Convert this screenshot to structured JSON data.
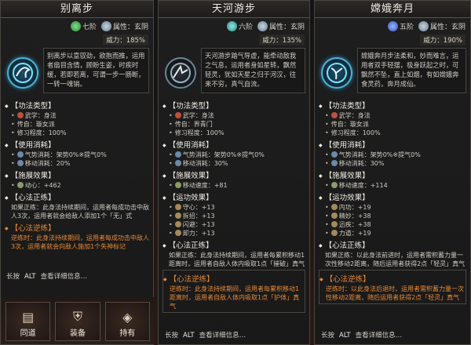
{
  "panels": [
    {
      "title": "别离步",
      "rank": "七阶",
      "attr": "属性：玄阴",
      "power": "威力：185%",
      "desc": "别离步以意驭劲，欲抱而推，运用者扇目含情，顾盼生姿，时疾时缓，若即若离，可谓一步一肠断，一转一魂销。",
      "func_h": "【功法类型】",
      "func": [
        "武学：身法",
        "传自：璇女派",
        "修习程度：100%"
      ],
      "use_h": "【使用消耗】",
      "use": [
        "气势消耗：架势0%※提气0%",
        "移动消耗：20%"
      ],
      "eff_h": "【施展效果】",
      "eff": [
        "动心：+462"
      ],
      "zheng_h": "【心法正练】",
      "zheng": "如果正练：此身法持续期间，运用者每成功击中敌人3次，运用者就会给敌人添加1个「无」式",
      "ni_h": "【心法逆练】",
      "ni": "逆练时：此身法持续期间，运用者每成功击中敌人3次，运用者就会向敌人施加1个失神标记",
      "foot_a": "长按",
      "foot_b": "ALT",
      "foot_c": "查看详细信息…"
    },
    {
      "title": "天河游步",
      "rank": "六阶",
      "attr": "属性：玄阴",
      "power": "威力：135%",
      "desc": "天河游步踏气导虚，能牵动敌我之气息，运用者身如星转，飘然轻灵，犹如天星之归于河汉，往来不穷，真气自流。",
      "func_h": "【功法类型】",
      "func": [
        "武学：身法",
        "传自：界青门",
        "修习程度：100%"
      ],
      "use_h": "【使用消耗】",
      "use": [
        "气势消耗：架势0%※提气0%",
        "移动消耗：30%"
      ],
      "eff_h": "【施展效果】",
      "eff": [
        "移动速度：+81"
      ],
      "yun_h": "【运功效果】",
      "yun": [
        "守心：+13",
        "拆招：+13",
        "闪避：+13",
        "卸力：+13"
      ],
      "zheng_h": "【心法正练】",
      "zheng": "如果正练：此身法持续期间，运用者每累积移动1距离时，运用者自敌人体内吸取1点「摧破」真气",
      "ni_h": "【心法逆练】",
      "ni": "逆练时：此身法持续期间，运用者每累积移动1距离时，运用者自敌人体内吸取1点「护体」真气",
      "foot_a": "长按",
      "foot_b": "ALT",
      "foot_c": "查看详细信息…"
    },
    {
      "title": "嫦娥奔月",
      "rank": "五阶",
      "attr": "属性：玄阴",
      "power": "威力：190%",
      "desc": "嫦娥奔月步法柔和，妙而难言，运用者双手轻摆，极身跃起之时，可飘然不坠，直上如烟，有如嫦娥奔食灵药，奔月成仙。",
      "func_h": "【功法类型】",
      "func": [
        "武学：身法",
        "传自：璇女派",
        "修习程度：100%"
      ],
      "use_h": "【使用消耗】",
      "use": [
        "气势消耗：架势0%※提气0%",
        "移动消耗：30%"
      ],
      "eff_h": "【施展效果】",
      "eff": [
        "移动速度：+114"
      ],
      "yun_h": "【运功效果】",
      "yun": [
        "内功：+19",
        "精妙：+38",
        "迅疾：+38",
        "力道：+19"
      ],
      "zheng_h": "【心法正练】",
      "zheng": "如果正练：以此身法前进时，运用者需积蓄力量一次性移动2距离，随后运用者获得2点「轻灵」真气",
      "ni_h": "【心法逆练】",
      "ni": "逆练时：以此身法后退时，运用者需积蓄力量一次性移动2距离，随后运用者获得2点「轻灵」真气",
      "foot_a": "长按",
      "foot_b": "ALT",
      "foot_c": "查看详细信息…"
    }
  ],
  "bottom": {
    "btn1": "同道",
    "btn2": "装备",
    "btn3": "持有"
  }
}
